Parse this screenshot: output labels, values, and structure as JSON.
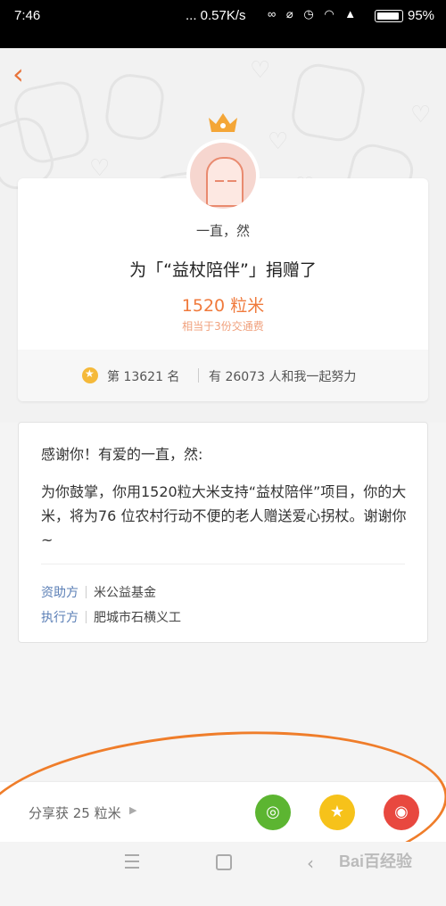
{
  "status_bar": {
    "time": "7:46",
    "network_speed": "... 0.57K/s",
    "icons": [
      "link-icon",
      "mute-icon",
      "alarm-icon",
      "wifi-icon",
      "signal-icon"
    ],
    "battery": "95%"
  },
  "header": {
    "back_icon": "chevron-left-icon",
    "crown_icon": "crown-icon",
    "accent_color": "#e8733a"
  },
  "donation": {
    "donor_name": "一直，然",
    "donate_line": "为「“益杖陪伴”」捐赠了",
    "amount": "1520 粒米",
    "equivalent": "相当于3份交通费",
    "rank": "第 13621 名",
    "together": "有 26073 人和我一起努力"
  },
  "message": {
    "thanks": "感谢你！有爱的一直，然:",
    "body": "为你鼓掌，你用1520粒大米支持“益杖陪伴”项目，你的大米，将为76 位农村行动不便的老人赠送爱心拐杖。谢谢你~",
    "sponsor_label": "资助方",
    "sponsor_value": "米公益基金",
    "executor_label": "执行方",
    "executor_value": "肥城市石横义工"
  },
  "share": {
    "label": "分享获 25 粒米",
    "buttons": [
      {
        "name": "moments-icon",
        "color": "#5cb531"
      },
      {
        "name": "favorite-icon",
        "color": "#f6c21a"
      },
      {
        "name": "weibo-icon",
        "color": "#e8483f"
      }
    ]
  },
  "nav_bar": {
    "icons": [
      "menu-icon",
      "home-icon",
      "back-icon"
    ]
  },
  "watermark": "Bai百经验",
  "annotation_color": "#ef7d2a"
}
